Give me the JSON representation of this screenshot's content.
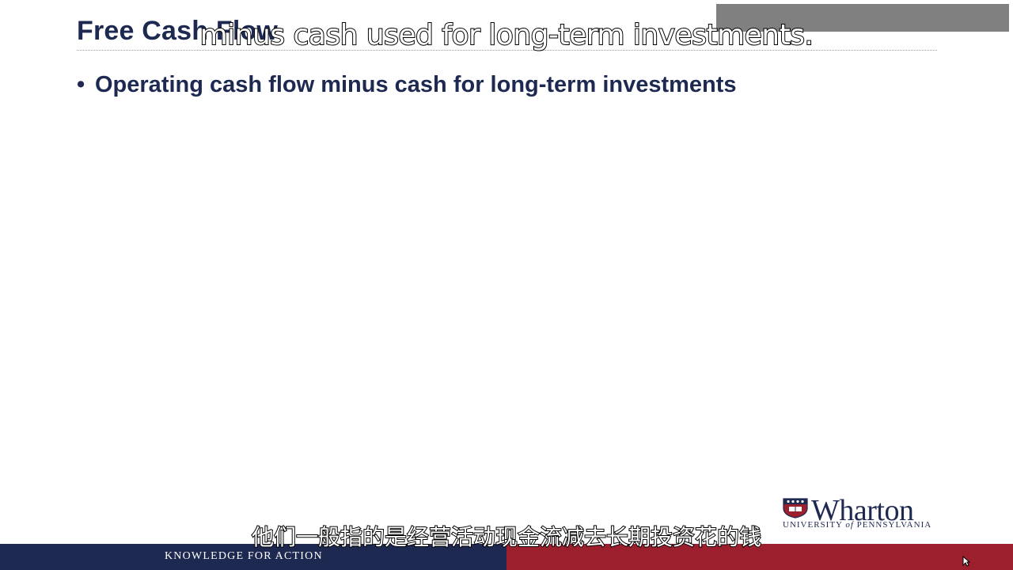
{
  "slide": {
    "title": "Free Cash Flow",
    "bullet_marker": "•",
    "bullet_text": "Operating cash flow minus cash for long-term investments"
  },
  "captions": {
    "english": "minus cash used for long-term investments.",
    "chinese": "他们一般指的是经营活动现金流减去长期投资花的钱"
  },
  "logo": {
    "name": "Wharton",
    "subtitle_prefix": "UNIVERSITY ",
    "subtitle_of": "of",
    "subtitle_suffix": " PENNSYLVANIA"
  },
  "footer": {
    "tagline": "KNOWLEDGE FOR ACTION"
  },
  "colors": {
    "navy": "#1d2950",
    "crimson": "#9c1f2e"
  },
  "icons": {
    "shield": "penn-shield-icon",
    "cursor": "mouse-cursor-icon"
  }
}
